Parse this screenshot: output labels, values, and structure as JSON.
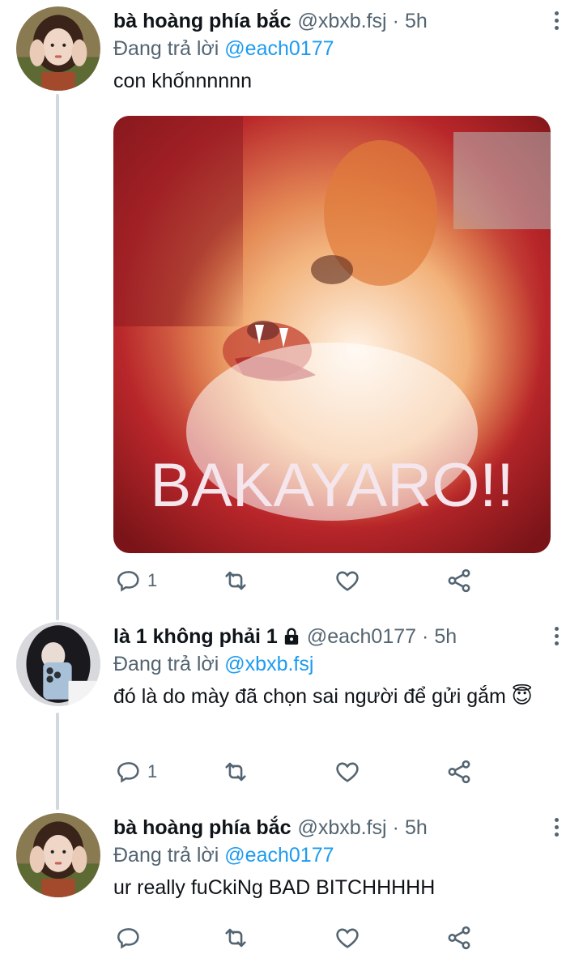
{
  "tweets": [
    {
      "name": "bà hoàng phía bắc",
      "handle": "@xbxb.fsj",
      "sep": "·",
      "time": "5h",
      "replying_prefix": "Đang trả lời",
      "replying_to": "@each0177",
      "text": "con khốnnnnnn",
      "media_caption": "BAKAYARO!!",
      "reply_count": "1",
      "locked": false
    },
    {
      "name": "là 1 không phải 1",
      "handle": "@each0177",
      "sep": "·",
      "time": "5h",
      "replying_prefix": "Đang trả lời",
      "replying_to": "@xbxb.fsj",
      "text": "đó là do mày đã chọn sai người để gửi gắm 😇",
      "reply_count": "1",
      "locked": true
    },
    {
      "name": "bà hoàng phía bắc",
      "handle": "@xbxb.fsj",
      "sep": "·",
      "time": "5h",
      "replying_prefix": "Đang trả lời",
      "replying_to": "@each0177",
      "text": "ur really fuCkiNg BAD BITCHHHHH",
      "reply_count": "",
      "locked": false
    }
  ],
  "icons": {
    "reply": "reply-icon",
    "retweet": "retweet-icon",
    "like": "like-icon",
    "share": "share-icon",
    "more": "more-icon",
    "lock": "lock-icon"
  },
  "colors": {
    "text": "#0f1419",
    "secondary": "#536471",
    "mention": "#1d9bf0",
    "thread_line": "#cfd9de"
  }
}
